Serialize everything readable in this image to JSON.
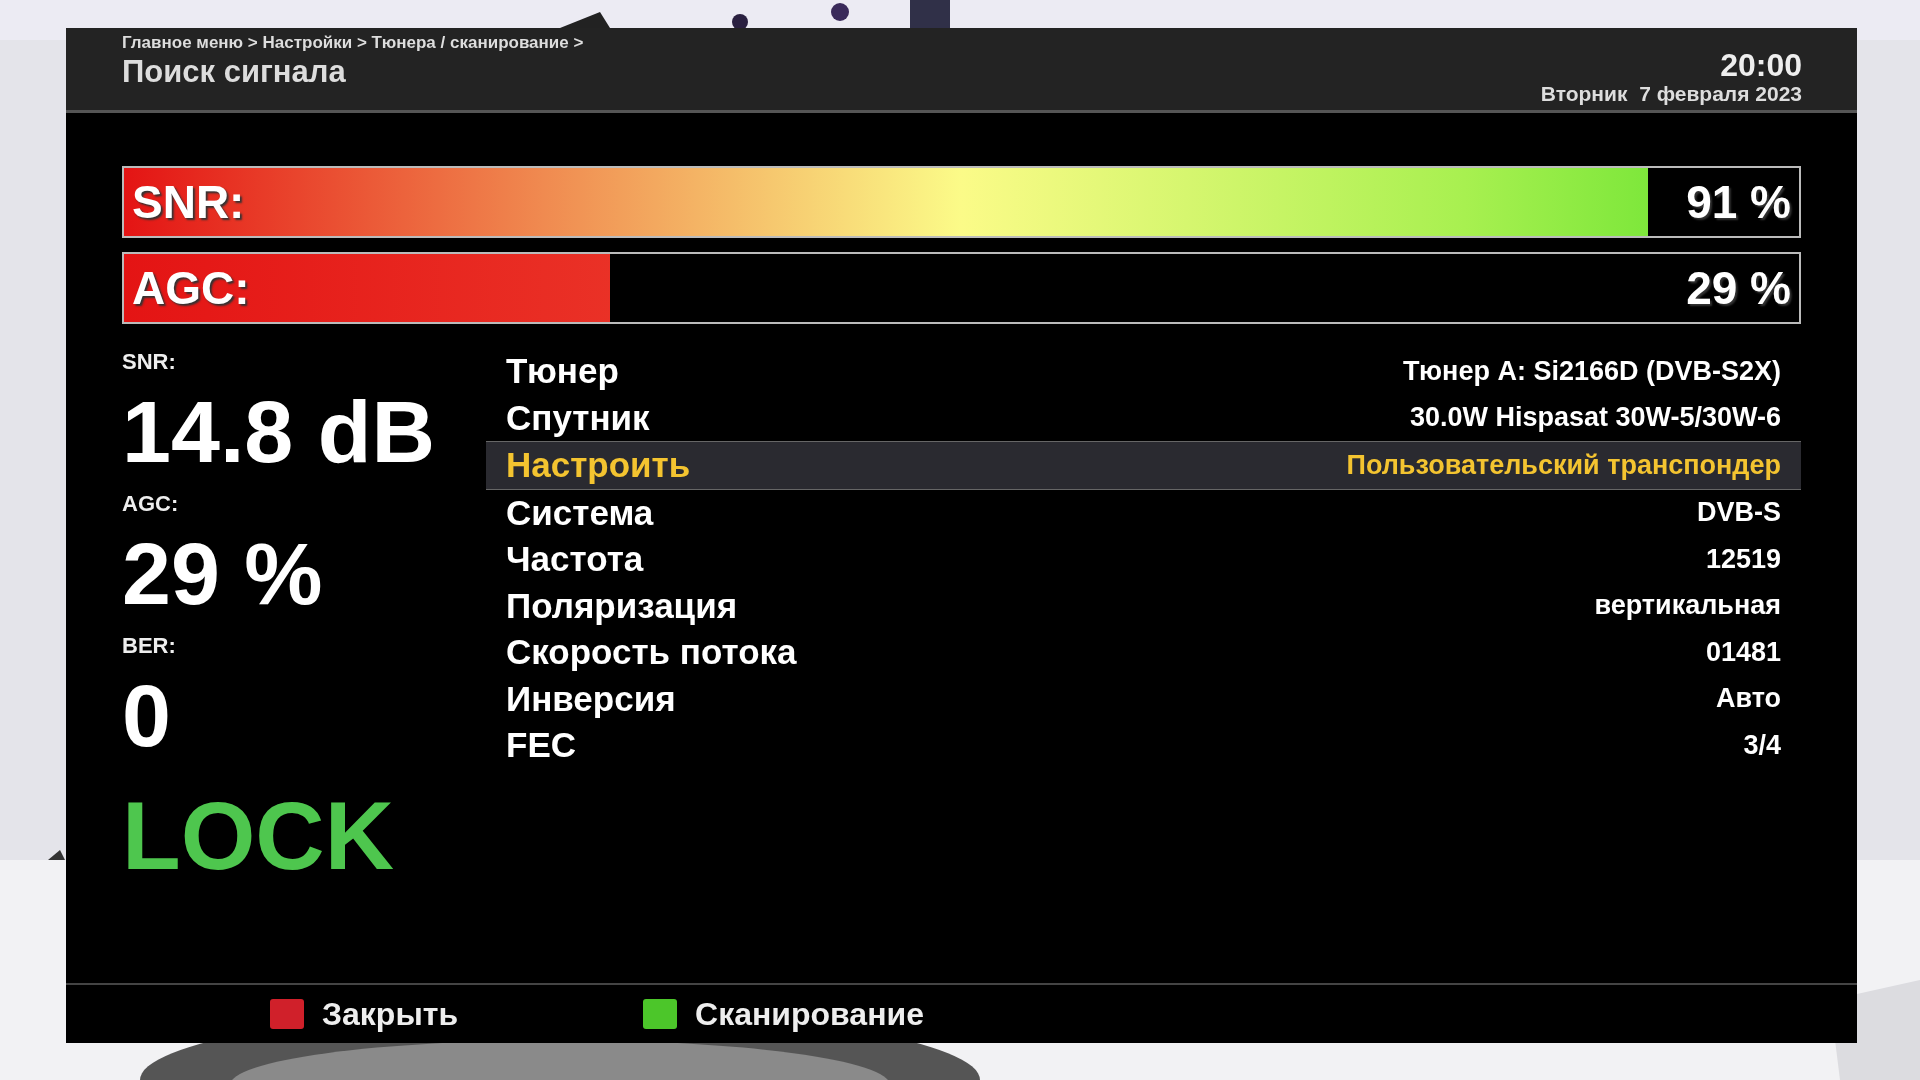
{
  "header": {
    "breadcrumb": "Главное меню > Настройки > Тюнера / сканирование >",
    "title": "Поиск сигнала",
    "time": "20:00",
    "date": "Вторник  7 февраля 2023"
  },
  "bars": [
    {
      "kind": "snr",
      "label": "SNR:",
      "level": 0.91,
      "reading": "91 %"
    },
    {
      "kind": "agc",
      "label": "AGC:",
      "level": 0.29,
      "reading": "29 %"
    }
  ],
  "stats": [
    {
      "label": "SNR:",
      "value": "14.8 dB"
    },
    {
      "label": "AGC:",
      "value": "29 %"
    },
    {
      "label": "BER:",
      "value": "0"
    }
  ],
  "status": "LOCK",
  "settings": [
    {
      "name": "Тюнер",
      "value": "Тюнер A: Si2166D (DVB-S2X)",
      "selected": false
    },
    {
      "name": "Спутник",
      "value": "30.0W Hispasat 30W-5/30W-6",
      "selected": false
    },
    {
      "name": "Настроить",
      "value": "Пользовательский транспондер",
      "selected": true
    },
    {
      "name": "Система",
      "value": "DVB-S",
      "selected": false
    },
    {
      "name": "Частота",
      "value": "12519",
      "selected": false
    },
    {
      "name": "Поляризация",
      "value": "вертикальная",
      "selected": false
    },
    {
      "name": "Скорость потока",
      "value": "01481",
      "selected": false
    },
    {
      "name": "Инверсия",
      "value": "Авто",
      "selected": false
    },
    {
      "name": "FEC",
      "value": "3/4",
      "selected": false
    }
  ],
  "buttons": [
    {
      "label": "Закрыть",
      "color": "#d0202a"
    },
    {
      "label": "Сканирование",
      "color": "#4cc62a"
    }
  ]
}
